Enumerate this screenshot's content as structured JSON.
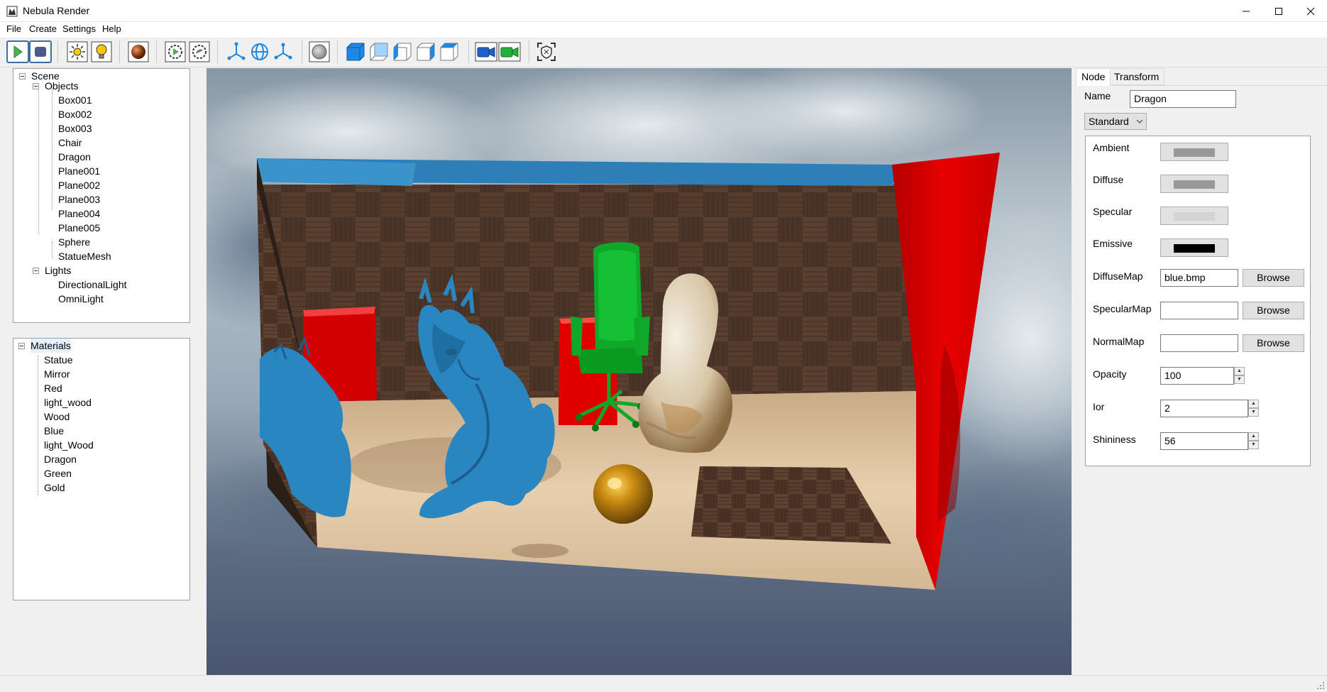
{
  "window": {
    "title": "Nebula Render",
    "controls": [
      "minimize-icon",
      "maximize-icon",
      "close-icon"
    ]
  },
  "menu": [
    "File",
    "Create",
    "Settings",
    "Help"
  ],
  "toolbar": {
    "groups": [
      [
        "render-play-icon",
        "stop-icon"
      ],
      [
        "sun-light-icon",
        "bulb-light-icon"
      ],
      [
        "material-sphere-icon"
      ],
      [
        "render-settings-icon",
        "scene-settings-icon"
      ],
      [
        "move-axis-icon",
        "rotate-globe-icon",
        "scale-axis-icon"
      ],
      [
        "sphere-object-icon"
      ],
      [
        "view-front-icon",
        "view-back-icon",
        "view-left-icon",
        "view-right-icon",
        "view-top-icon"
      ],
      [
        "camera-blue-icon",
        "camera-green-icon"
      ],
      [
        "focus-shield-icon"
      ]
    ]
  },
  "scene_tree": {
    "root": "Scene",
    "groups": [
      {
        "label": "Objects",
        "items": [
          "Box001",
          "Box002",
          "Box003",
          "Chair",
          "Dragon",
          "Plane001",
          "Plane002",
          "Plane003",
          "Plane004",
          "Plane005",
          "Sphere",
          "StatueMesh"
        ]
      },
      {
        "label": "Lights",
        "items": [
          "DirectionalLight",
          "OmniLight"
        ]
      }
    ]
  },
  "materials_tree": {
    "root": "Materials",
    "items": [
      "Statue",
      "Mirror",
      "Red",
      "light_wood",
      "Wood",
      "Blue",
      "light_Wood",
      "Dragon",
      "Green",
      "Gold"
    ]
  },
  "properties": {
    "tabs": [
      "Node",
      "Transform"
    ],
    "active_tab": "Node",
    "name_label": "Name",
    "name_value": "Dragon",
    "material_type": "Standard",
    "colors": [
      {
        "label": "Ambient",
        "color": "#999999"
      },
      {
        "label": "Diffuse",
        "color": "#999999"
      },
      {
        "label": "Specular",
        "color": "#d3d3d3"
      },
      {
        "label": "Emissive",
        "color": "#000000"
      }
    ],
    "maps": [
      {
        "label": "DiffuseMap",
        "value": "blue.bmp",
        "button": "Browse"
      },
      {
        "label": "SpecularMap",
        "value": "",
        "button": "Browse"
      },
      {
        "label": "NormalMap",
        "value": "",
        "button": "Browse"
      }
    ],
    "numbers": [
      {
        "label": "Opacity",
        "value": "100"
      },
      {
        "label": "Ior",
        "value": "2"
      },
      {
        "label": "Shininess",
        "value": "56"
      }
    ]
  },
  "colors": {
    "accent_blue": "#1e88e5",
    "box_red": "#e00000",
    "dragon_blue": "#2a86c0",
    "chair_green": "#0fa82a",
    "gold": "#c08a10"
  }
}
